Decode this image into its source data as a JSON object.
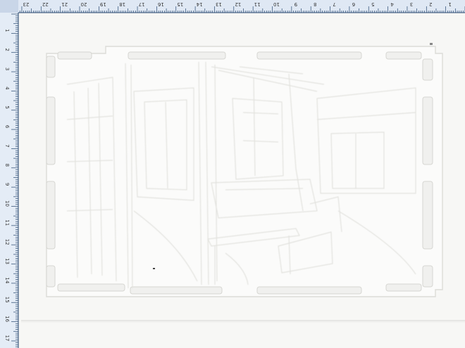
{
  "scan": {
    "paper_color": "#f7f7f5",
    "embossed_panel_color": "#fbfbfa",
    "ruler_color": "#dfe8f4",
    "ruler_tick_color": "#26466e"
  },
  "rulers": {
    "top_labels": [
      "24",
      "23",
      "22",
      "21",
      "20",
      "19",
      "18",
      "17",
      "16",
      "15",
      "14",
      "13",
      "12",
      "11",
      "10",
      "9",
      "8",
      "7",
      "6",
      "5",
      "4",
      "3",
      "2",
      "1"
    ],
    "left_labels": [
      "1",
      "2",
      "3",
      "4",
      "5",
      "6",
      "7",
      "8",
      "9",
      "10",
      "11",
      "12",
      "13",
      "14",
      "15",
      "16",
      "17"
    ]
  },
  "artwork": {
    "subject": "blind-embossed interior scene",
    "icon": "emboss-relief"
  }
}
